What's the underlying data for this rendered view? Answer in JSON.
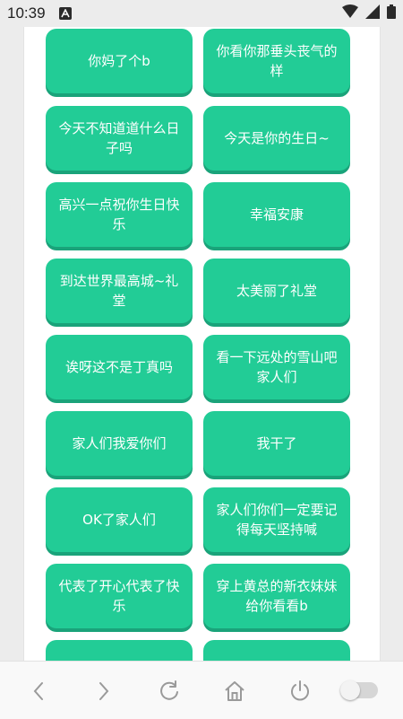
{
  "status_bar": {
    "time": "10:39",
    "icons": [
      "a-notification-icon",
      "wifi-icon",
      "signal-icon",
      "battery-icon"
    ]
  },
  "cards": [
    {
      "text": "你妈了个b"
    },
    {
      "text": "你看你那垂头丧气的样"
    },
    {
      "text": "今天不知道道什么日子吗"
    },
    {
      "text": "今天是你的生日~"
    },
    {
      "text": "高兴一点祝你生日快乐"
    },
    {
      "text": "幸福安康"
    },
    {
      "text": "到达世界最高城~礼堂"
    },
    {
      "text": "太美丽了礼堂"
    },
    {
      "text": "诶呀这不是丁真吗"
    },
    {
      "text": "看一下远处的雪山吧家人们"
    },
    {
      "text": "家人们我爱你们"
    },
    {
      "text": "我干了"
    },
    {
      "text": "OK了家人们"
    },
    {
      "text": "家人们你们一定要记得每天坚持喊"
    },
    {
      "text": "代表了开心代表了快乐"
    },
    {
      "text": "穿上黄总的新衣妹妹给你看看b"
    },
    {
      "text": ""
    },
    {
      "text": ""
    }
  ],
  "bottom_nav": {
    "items": [
      "back-icon",
      "forward-icon",
      "refresh-icon",
      "home-icon",
      "power-icon",
      "toggle-switch"
    ]
  },
  "colors": {
    "card": "#22cc96",
    "card_shadow": "#1aa37a",
    "background": "#ececec"
  }
}
